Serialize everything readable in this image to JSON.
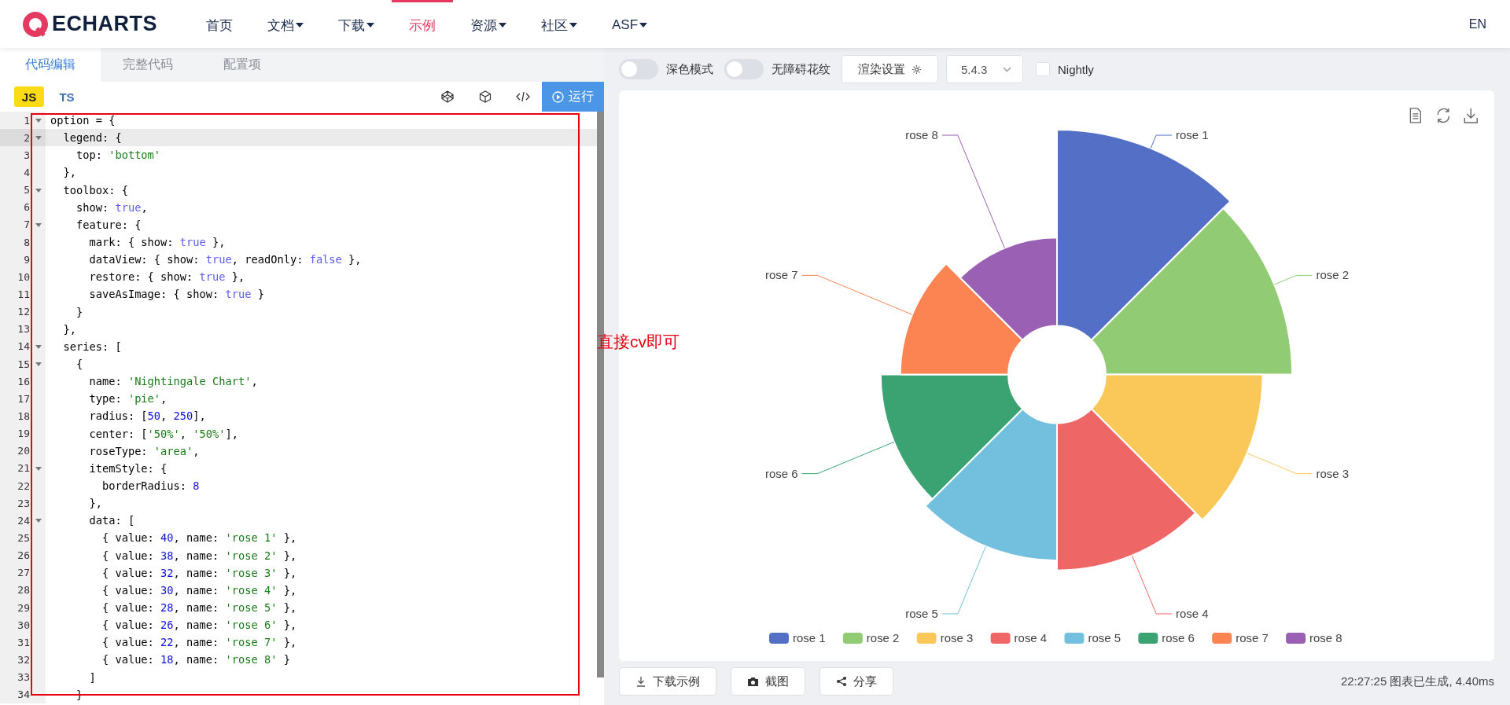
{
  "header": {
    "logo": "ECHARTS",
    "nav": [
      {
        "label": "首页",
        "dropdown": false,
        "selected": false
      },
      {
        "label": "文档",
        "dropdown": true,
        "selected": false
      },
      {
        "label": "下载",
        "dropdown": true,
        "selected": false
      },
      {
        "label": "示例",
        "dropdown": false,
        "selected": true
      },
      {
        "label": "资源",
        "dropdown": true,
        "selected": false
      },
      {
        "label": "社区",
        "dropdown": true,
        "selected": false
      },
      {
        "label": "ASF",
        "dropdown": true,
        "selected": false
      }
    ],
    "language": "EN"
  },
  "editor": {
    "tabs": [
      {
        "label": "代码编辑",
        "selected": true
      },
      {
        "label": "完整代码",
        "selected": false
      },
      {
        "label": "配置项",
        "selected": false
      }
    ],
    "languages": [
      {
        "label": "JS",
        "selected": true
      },
      {
        "label": "TS",
        "selected": false
      }
    ],
    "run_button": "运行",
    "lines": [
      {
        "number": "1",
        "fold": true,
        "active": false,
        "tokens": [
          {
            "kind": "plain",
            "text": "option = {"
          }
        ]
      },
      {
        "number": "2",
        "fold": true,
        "active": true,
        "tokens": [
          {
            "kind": "plain",
            "text": "  legend: {"
          }
        ]
      },
      {
        "number": "3",
        "fold": false,
        "active": false,
        "tokens": [
          {
            "kind": "plain",
            "text": "    top: "
          },
          {
            "kind": "string",
            "text": "'bottom'"
          }
        ]
      },
      {
        "number": "4",
        "fold": false,
        "active": false,
        "tokens": [
          {
            "kind": "plain",
            "text": "  },"
          }
        ]
      },
      {
        "number": "5",
        "fold": true,
        "active": false,
        "tokens": [
          {
            "kind": "plain",
            "text": "  toolbox: {"
          }
        ]
      },
      {
        "number": "6",
        "fold": false,
        "active": false,
        "tokens": [
          {
            "kind": "plain",
            "text": "    show: "
          },
          {
            "kind": "keyword",
            "text": "true"
          },
          {
            "kind": "plain",
            "text": ","
          }
        ]
      },
      {
        "number": "7",
        "fold": true,
        "active": false,
        "tokens": [
          {
            "kind": "plain",
            "text": "    feature: {"
          }
        ]
      },
      {
        "number": "8",
        "fold": false,
        "active": false,
        "tokens": [
          {
            "kind": "plain",
            "text": "      mark: { show: "
          },
          {
            "kind": "keyword",
            "text": "true"
          },
          {
            "kind": "plain",
            "text": " },"
          }
        ]
      },
      {
        "number": "9",
        "fold": false,
        "active": false,
        "tokens": [
          {
            "kind": "plain",
            "text": "      dataView: { show: "
          },
          {
            "kind": "keyword",
            "text": "true"
          },
          {
            "kind": "plain",
            "text": ", readOnly: "
          },
          {
            "kind": "keyword",
            "text": "false"
          },
          {
            "kind": "plain",
            "text": " },"
          }
        ]
      },
      {
        "number": "10",
        "fold": false,
        "active": false,
        "tokens": [
          {
            "kind": "plain",
            "text": "      restore: { show: "
          },
          {
            "kind": "keyword",
            "text": "true"
          },
          {
            "kind": "plain",
            "text": " },"
          }
        ]
      },
      {
        "number": "11",
        "fold": false,
        "active": false,
        "tokens": [
          {
            "kind": "plain",
            "text": "      saveAsImage: { show: "
          },
          {
            "kind": "keyword",
            "text": "true"
          },
          {
            "kind": "plain",
            "text": " }"
          }
        ]
      },
      {
        "number": "12",
        "fold": false,
        "active": false,
        "tokens": [
          {
            "kind": "plain",
            "text": "    }"
          }
        ]
      },
      {
        "number": "13",
        "fold": false,
        "active": false,
        "tokens": [
          {
            "kind": "plain",
            "text": "  },"
          }
        ]
      },
      {
        "number": "14",
        "fold": true,
        "active": false,
        "tokens": [
          {
            "kind": "plain",
            "text": "  series: ["
          }
        ]
      },
      {
        "number": "15",
        "fold": true,
        "active": false,
        "tokens": [
          {
            "kind": "plain",
            "text": "    {"
          }
        ]
      },
      {
        "number": "16",
        "fold": false,
        "active": false,
        "tokens": [
          {
            "kind": "plain",
            "text": "      name: "
          },
          {
            "kind": "string",
            "text": "'Nightingale Chart'"
          },
          {
            "kind": "plain",
            "text": ","
          }
        ]
      },
      {
        "number": "17",
        "fold": false,
        "active": false,
        "tokens": [
          {
            "kind": "plain",
            "text": "      type: "
          },
          {
            "kind": "string",
            "text": "'pie'"
          },
          {
            "kind": "plain",
            "text": ","
          }
        ]
      },
      {
        "number": "18",
        "fold": false,
        "active": false,
        "tokens": [
          {
            "kind": "plain",
            "text": "      radius: ["
          },
          {
            "kind": "number",
            "text": "50"
          },
          {
            "kind": "plain",
            "text": ", "
          },
          {
            "kind": "number",
            "text": "250"
          },
          {
            "kind": "plain",
            "text": "],"
          }
        ]
      },
      {
        "number": "19",
        "fold": false,
        "active": false,
        "tokens": [
          {
            "kind": "plain",
            "text": "      center: ["
          },
          {
            "kind": "string",
            "text": "'50%'"
          },
          {
            "kind": "plain",
            "text": ", "
          },
          {
            "kind": "string",
            "text": "'50%'"
          },
          {
            "kind": "plain",
            "text": "],"
          }
        ]
      },
      {
        "number": "20",
        "fold": false,
        "active": false,
        "tokens": [
          {
            "kind": "plain",
            "text": "      roseType: "
          },
          {
            "kind": "string",
            "text": "'area'"
          },
          {
            "kind": "plain",
            "text": ","
          }
        ]
      },
      {
        "number": "21",
        "fold": true,
        "active": false,
        "tokens": [
          {
            "kind": "plain",
            "text": "      itemStyle: {"
          }
        ]
      },
      {
        "number": "22",
        "fold": false,
        "active": false,
        "tokens": [
          {
            "kind": "plain",
            "text": "        borderRadius: "
          },
          {
            "kind": "number",
            "text": "8"
          }
        ]
      },
      {
        "number": "23",
        "fold": false,
        "active": false,
        "tokens": [
          {
            "kind": "plain",
            "text": "      },"
          }
        ]
      },
      {
        "number": "24",
        "fold": true,
        "active": false,
        "tokens": [
          {
            "kind": "plain",
            "text": "      data: ["
          }
        ]
      },
      {
        "number": "25",
        "fold": false,
        "active": false,
        "tokens": [
          {
            "kind": "plain",
            "text": "        { value: "
          },
          {
            "kind": "number",
            "text": "40"
          },
          {
            "kind": "plain",
            "text": ", name: "
          },
          {
            "kind": "string",
            "text": "'rose 1'"
          },
          {
            "kind": "plain",
            "text": " },"
          }
        ]
      },
      {
        "number": "26",
        "fold": false,
        "active": false,
        "tokens": [
          {
            "kind": "plain",
            "text": "        { value: "
          },
          {
            "kind": "number",
            "text": "38"
          },
          {
            "kind": "plain",
            "text": ", name: "
          },
          {
            "kind": "string",
            "text": "'rose 2'"
          },
          {
            "kind": "plain",
            "text": " },"
          }
        ]
      },
      {
        "number": "27",
        "fold": false,
        "active": false,
        "tokens": [
          {
            "kind": "plain",
            "text": "        { value: "
          },
          {
            "kind": "number",
            "text": "32"
          },
          {
            "kind": "plain",
            "text": ", name: "
          },
          {
            "kind": "string",
            "text": "'rose 3'"
          },
          {
            "kind": "plain",
            "text": " },"
          }
        ]
      },
      {
        "number": "28",
        "fold": false,
        "active": false,
        "tokens": [
          {
            "kind": "plain",
            "text": "        { value: "
          },
          {
            "kind": "number",
            "text": "30"
          },
          {
            "kind": "plain",
            "text": ", name: "
          },
          {
            "kind": "string",
            "text": "'rose 4'"
          },
          {
            "kind": "plain",
            "text": " },"
          }
        ]
      },
      {
        "number": "29",
        "fold": false,
        "active": false,
        "tokens": [
          {
            "kind": "plain",
            "text": "        { value: "
          },
          {
            "kind": "number",
            "text": "28"
          },
          {
            "kind": "plain",
            "text": ", name: "
          },
          {
            "kind": "string",
            "text": "'rose 5'"
          },
          {
            "kind": "plain",
            "text": " },"
          }
        ]
      },
      {
        "number": "30",
        "fold": false,
        "active": false,
        "tokens": [
          {
            "kind": "plain",
            "text": "        { value: "
          },
          {
            "kind": "number",
            "text": "26"
          },
          {
            "kind": "plain",
            "text": ", name: "
          },
          {
            "kind": "string",
            "text": "'rose 6'"
          },
          {
            "kind": "plain",
            "text": " },"
          }
        ]
      },
      {
        "number": "31",
        "fold": false,
        "active": false,
        "tokens": [
          {
            "kind": "plain",
            "text": "        { value: "
          },
          {
            "kind": "number",
            "text": "22"
          },
          {
            "kind": "plain",
            "text": ", name: "
          },
          {
            "kind": "string",
            "text": "'rose 7'"
          },
          {
            "kind": "plain",
            "text": " },"
          }
        ]
      },
      {
        "number": "32",
        "fold": false,
        "active": false,
        "tokens": [
          {
            "kind": "plain",
            "text": "        { value: "
          },
          {
            "kind": "number",
            "text": "18"
          },
          {
            "kind": "plain",
            "text": ", name: "
          },
          {
            "kind": "string",
            "text": "'rose 8'"
          },
          {
            "kind": "plain",
            "text": " }"
          }
        ]
      },
      {
        "number": "33",
        "fold": false,
        "active": false,
        "tokens": [
          {
            "kind": "plain",
            "text": "      ]"
          }
        ]
      },
      {
        "number": "34",
        "fold": false,
        "active": false,
        "tokens": [
          {
            "kind": "plain",
            "text": "    }"
          }
        ]
      }
    ],
    "annotation": "直接cv即可"
  },
  "preview": {
    "dark_mode": {
      "label": "深色模式",
      "on": false
    },
    "pattern": {
      "label": "无障碍花纹",
      "on": false
    },
    "render_settings": "渲染设置",
    "version": "5.4.3",
    "nightly": {
      "label": "Nightly",
      "checked": false
    },
    "slice_labels": [
      "rose 1",
      "rose 2",
      "rose 3",
      "rose 4",
      "rose 5",
      "rose 6",
      "rose 7",
      "rose 8"
    ],
    "legend": [
      {
        "label": "rose 1",
        "color": "#5470c6"
      },
      {
        "label": "rose 2",
        "color": "#91cc75"
      },
      {
        "label": "rose 3",
        "color": "#fac858"
      },
      {
        "label": "rose 4",
        "color": "#ee6666"
      },
      {
        "label": "rose 5",
        "color": "#73c0de"
      },
      {
        "label": "rose 6",
        "color": "#3ba272"
      },
      {
        "label": "rose 7",
        "color": "#fc8452"
      },
      {
        "label": "rose 8",
        "color": "#9a60b4"
      }
    ],
    "actions": [
      {
        "kind": "download",
        "label": "下载示例"
      },
      {
        "kind": "screenshot",
        "label": "截图"
      },
      {
        "kind": "share",
        "label": "分享"
      }
    ],
    "status": "22:27:25 图表已生成, 4.40ms"
  }
}
